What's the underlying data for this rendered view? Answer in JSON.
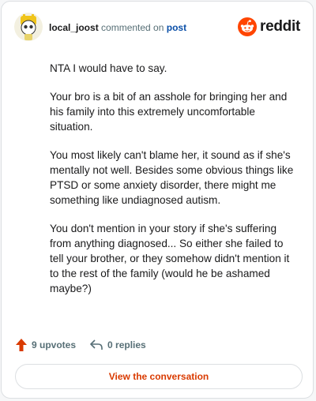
{
  "header": {
    "username": "local_joost",
    "commented_on": "commented on",
    "post_link": "post",
    "brand": "reddit"
  },
  "comment": {
    "paragraphs": [
      "NTA I would have to say.",
      "Your bro is a bit of an asshole for bringing her and his family into this extremely uncomfortable situation.",
      "You most likely can't blame her, it sound as if she's mentally not well. Besides some obvious things like PTSD or some anxiety disorder, there might me something like undiagnosed autism.",
      "You don't mention in your story if she's suffering from anything diagnosed... So either she failed to tell your brother, or they somehow didn't mention it to the rest of the family (would he be ashamed maybe?)"
    ]
  },
  "actions": {
    "upvotes": "9 upvotes",
    "replies": "0 replies"
  },
  "cta": {
    "label": "View the conversation"
  },
  "colors": {
    "brand": "#ff4500",
    "upvote": "#d93a00",
    "link": "#0a4fa8"
  },
  "icons": {
    "upvote": "arrow-up-icon",
    "reply": "reply-arrow-icon",
    "brand": "reddit-snoo-icon"
  }
}
